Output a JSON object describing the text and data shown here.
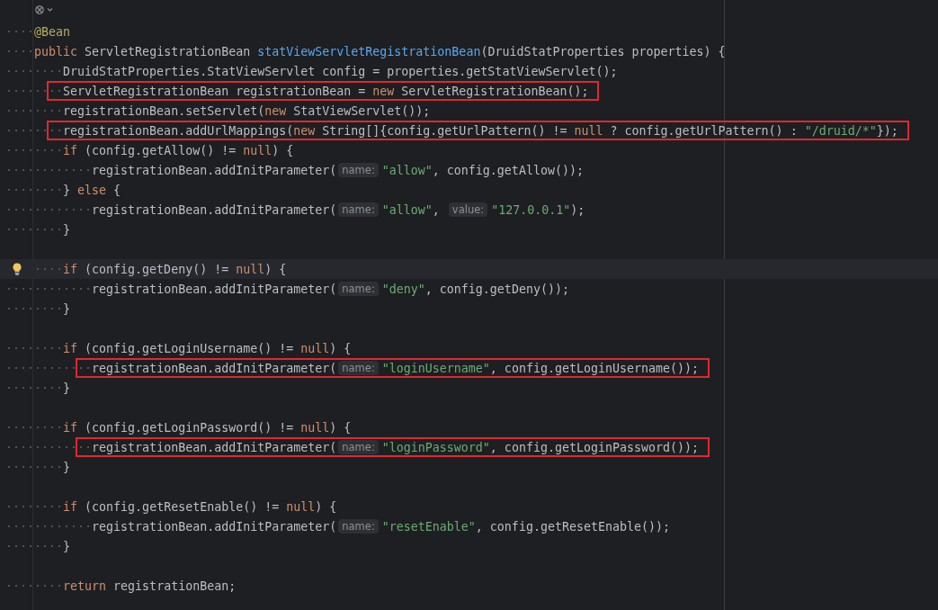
{
  "editor": {
    "lines": [
      {
        "indent": "····",
        "segments": [
          {
            "kind": "code",
            "tokens": [
              {
                "text": "@Bean",
                "kind": "ann"
              }
            ]
          }
        ]
      },
      {
        "indent": "····",
        "segments": [
          {
            "kind": "code",
            "tokens": [
              {
                "text": "public ",
                "kind": "kw"
              },
              {
                "text": "ServletRegistrationBean ",
                "kind": "txt"
              },
              {
                "text": "statViewServletRegistrationBean",
                "kind": "fn"
              },
              {
                "text": "(DruidStatProperties properties) {",
                "kind": "txt"
              }
            ]
          }
        ]
      },
      {
        "indent": "········",
        "segments": [
          {
            "kind": "code",
            "tokens": [
              {
                "text": "DruidStatProperties.StatViewServlet config = properties.getStatViewServlet();",
                "kind": "txt"
              }
            ]
          }
        ]
      },
      {
        "indent": "········",
        "boxed": true,
        "segments": [
          {
            "kind": "code",
            "tokens": [
              {
                "text": "ServletRegistrationBean registrationBean = ",
                "kind": "txt"
              },
              {
                "text": "new ",
                "kind": "kw"
              },
              {
                "text": "ServletRegistrationBean();",
                "kind": "txt"
              }
            ]
          }
        ]
      },
      {
        "indent": "········",
        "segments": [
          {
            "kind": "code",
            "tokens": [
              {
                "text": "registrationBean.setServlet(",
                "kind": "txt"
              },
              {
                "text": "new ",
                "kind": "kw"
              },
              {
                "text": "StatViewServlet());",
                "kind": "txt"
              }
            ]
          }
        ]
      },
      {
        "indent": "········",
        "boxed": true,
        "segments": [
          {
            "kind": "code",
            "tokens": [
              {
                "text": "registrationBean.addUrlMappings(",
                "kind": "txt"
              },
              {
                "text": "new ",
                "kind": "kw"
              },
              {
                "text": "String[]{config.getUrlPattern() != ",
                "kind": "txt"
              },
              {
                "text": "null ",
                "kind": "kw"
              },
              {
                "text": "? config.getUrlPattern() : ",
                "kind": "txt"
              },
              {
                "text": "\"/druid/*\"",
                "kind": "str"
              },
              {
                "text": "});",
                "kind": "txt"
              }
            ]
          }
        ]
      },
      {
        "indent": "········",
        "segments": [
          {
            "kind": "code",
            "tokens": [
              {
                "text": "if ",
                "kind": "kw"
              },
              {
                "text": "(config.getAllow() != ",
                "kind": "txt"
              },
              {
                "text": "null",
                "kind": "kw"
              },
              {
                "text": ") {",
                "kind": "txt"
              }
            ]
          }
        ]
      },
      {
        "indent": "············",
        "segments": [
          {
            "kind": "code",
            "tokens": [
              {
                "text": "registrationBean.addInitParameter(",
                "kind": "txt"
              }
            ]
          },
          {
            "kind": "hint",
            "text": "name:"
          },
          {
            "kind": "code",
            "tokens": [
              {
                "text": "\"allow\"",
                "kind": "str"
              },
              {
                "text": ", config.getAllow());",
                "kind": "txt"
              }
            ]
          }
        ]
      },
      {
        "indent": "········",
        "segments": [
          {
            "kind": "code",
            "tokens": [
              {
                "text": "} ",
                "kind": "txt"
              },
              {
                "text": "else ",
                "kind": "kw"
              },
              {
                "text": "{",
                "kind": "txt"
              }
            ]
          }
        ]
      },
      {
        "indent": "············",
        "segments": [
          {
            "kind": "code",
            "tokens": [
              {
                "text": "registrationBean.addInitParameter(",
                "kind": "txt"
              }
            ]
          },
          {
            "kind": "hint",
            "text": "name:"
          },
          {
            "kind": "code",
            "tokens": [
              {
                "text": "\"allow\"",
                "kind": "str"
              },
              {
                "text": ", ",
                "kind": "txt"
              }
            ]
          },
          {
            "kind": "hint",
            "text": "value:"
          },
          {
            "kind": "code",
            "tokens": [
              {
                "text": "\"127.0.0.1\"",
                "kind": "str"
              },
              {
                "text": ");",
                "kind": "txt"
              }
            ]
          }
        ]
      },
      {
        "indent": "········",
        "segments": [
          {
            "kind": "code",
            "tokens": [
              {
                "text": "}",
                "kind": "txt"
              }
            ]
          }
        ]
      },
      {
        "kind": "blank"
      },
      {
        "indent": "····",
        "current": true,
        "bulb": true,
        "segments": [
          {
            "kind": "code",
            "tokens": [
              {
                "text": "if ",
                "kind": "kw"
              },
              {
                "text": "(config.getDeny() != ",
                "kind": "txt"
              },
              {
                "text": "null",
                "kind": "kw"
              },
              {
                "text": ") {",
                "kind": "txt"
              }
            ]
          }
        ]
      },
      {
        "indent": "············",
        "segments": [
          {
            "kind": "code",
            "tokens": [
              {
                "text": "registrationBean.addInitParameter(",
                "kind": "txt"
              }
            ]
          },
          {
            "kind": "hint",
            "text": "name:"
          },
          {
            "kind": "code",
            "tokens": [
              {
                "text": "\"deny\"",
                "kind": "str"
              },
              {
                "text": ", config.getDeny());",
                "kind": "txt"
              }
            ]
          }
        ]
      },
      {
        "indent": "········",
        "segments": [
          {
            "kind": "code",
            "tokens": [
              {
                "text": "}",
                "kind": "txt"
              }
            ]
          }
        ]
      },
      {
        "kind": "blank"
      },
      {
        "indent": "········",
        "segments": [
          {
            "kind": "code",
            "tokens": [
              {
                "text": "if ",
                "kind": "kw"
              },
              {
                "text": "(config.getLoginUsername() != ",
                "kind": "txt"
              },
              {
                "text": "null",
                "kind": "kw"
              },
              {
                "text": ") {",
                "kind": "txt"
              }
            ]
          }
        ]
      },
      {
        "indent": "············",
        "boxed": true,
        "segments": [
          {
            "kind": "code",
            "tokens": [
              {
                "text": "registrationBean.addInitParameter(",
                "kind": "txt"
              }
            ]
          },
          {
            "kind": "hint",
            "text": "name:"
          },
          {
            "kind": "code",
            "tokens": [
              {
                "text": "\"loginUsername\"",
                "kind": "str"
              },
              {
                "text": ", config.getLoginUsername());",
                "kind": "txt"
              }
            ]
          }
        ]
      },
      {
        "indent": "········",
        "segments": [
          {
            "kind": "code",
            "tokens": [
              {
                "text": "}",
                "kind": "txt"
              }
            ]
          }
        ]
      },
      {
        "kind": "blank"
      },
      {
        "indent": "········",
        "segments": [
          {
            "kind": "code",
            "tokens": [
              {
                "text": "if ",
                "kind": "kw"
              },
              {
                "text": "(config.getLoginPassword() != ",
                "kind": "txt"
              },
              {
                "text": "null",
                "kind": "kw"
              },
              {
                "text": ") {",
                "kind": "txt"
              }
            ]
          }
        ]
      },
      {
        "indent": "············",
        "boxed": true,
        "segments": [
          {
            "kind": "code",
            "tokens": [
              {
                "text": "registrationBean.addInitParameter(",
                "kind": "txt"
              }
            ]
          },
          {
            "kind": "hint",
            "text": "name:"
          },
          {
            "kind": "code",
            "tokens": [
              {
                "text": "\"loginPassword\"",
                "kind": "str"
              },
              {
                "text": ", config.getLoginPassword());",
                "kind": "txt"
              }
            ]
          }
        ]
      },
      {
        "indent": "········",
        "segments": [
          {
            "kind": "code",
            "tokens": [
              {
                "text": "}",
                "kind": "txt"
              }
            ]
          }
        ]
      },
      {
        "kind": "blank"
      },
      {
        "indent": "········",
        "segments": [
          {
            "kind": "code",
            "tokens": [
              {
                "text": "if ",
                "kind": "kw"
              },
              {
                "text": "(config.getResetEnable() != ",
                "kind": "txt"
              },
              {
                "text": "null",
                "kind": "kw"
              },
              {
                "text": ") {",
                "kind": "txt"
              }
            ]
          }
        ]
      },
      {
        "indent": "············",
        "segments": [
          {
            "kind": "code",
            "tokens": [
              {
                "text": "registrationBean.addInitParameter(",
                "kind": "txt"
              }
            ]
          },
          {
            "kind": "hint",
            "text": "name:"
          },
          {
            "kind": "code",
            "tokens": [
              {
                "text": "\"resetEnable\"",
                "kind": "str"
              },
              {
                "text": ", config.getResetEnable());",
                "kind": "txt"
              }
            ]
          }
        ]
      },
      {
        "indent": "········",
        "segments": [
          {
            "kind": "code",
            "tokens": [
              {
                "text": "}",
                "kind": "txt"
              }
            ]
          }
        ]
      },
      {
        "kind": "blank"
      },
      {
        "indent": "········",
        "segments": [
          {
            "kind": "code",
            "tokens": [
              {
                "text": "return ",
                "kind": "kw"
              },
              {
                "text": "registrationBean;",
                "kind": "txt"
              }
            ]
          }
        ]
      }
    ]
  }
}
